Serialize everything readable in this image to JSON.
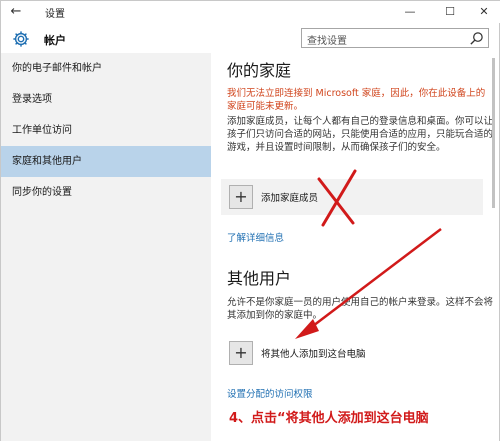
{
  "window": {
    "title": "设置",
    "back_glyph": "←",
    "minimize_glyph": "—",
    "maximize_glyph": "☐",
    "close_glyph": "✕"
  },
  "header": {
    "section_title": "帐户",
    "search_placeholder": "查找设置"
  },
  "sidebar": {
    "items": [
      {
        "label": "你的电子邮件和帐户",
        "active": false
      },
      {
        "label": "登录选项",
        "active": false
      },
      {
        "label": "工作单位访问",
        "active": false
      },
      {
        "label": "家庭和其他用户",
        "active": true
      },
      {
        "label": "同步你的设置",
        "active": false
      }
    ]
  },
  "main": {
    "family": {
      "heading": "你的家庭",
      "warning": "我们无法立即连接到 Microsoft 家庭，因此，你在此设备上的家庭可能未更新。",
      "description": "添加家庭成员，让每个人都有自己的登录信息和桌面。你可以让孩子们只访问合适的网站，只能使用合适的应用，只能玩合适的游戏，并且设置时间限制，从而确保孩子们的安全。",
      "add_tile_label": "添加家庭成员",
      "learn_more": "了解详细信息"
    },
    "others": {
      "heading": "其他用户",
      "description": "允许不是你家庭一员的用户使用自己的帐户来登录。这样不会将其添加到你的家庭中。",
      "add_tile_label": "将其他人添加到这台电脑",
      "assigned_access": "设置分配的访问权限"
    }
  },
  "annotation": {
    "caption": "4、点击“将其他人添加到这台电脑",
    "color": "#d11a1a"
  },
  "colors": {
    "accent_selected": "#b9d3ea",
    "warning": "#d0441c",
    "link": "#1f6fb2"
  }
}
